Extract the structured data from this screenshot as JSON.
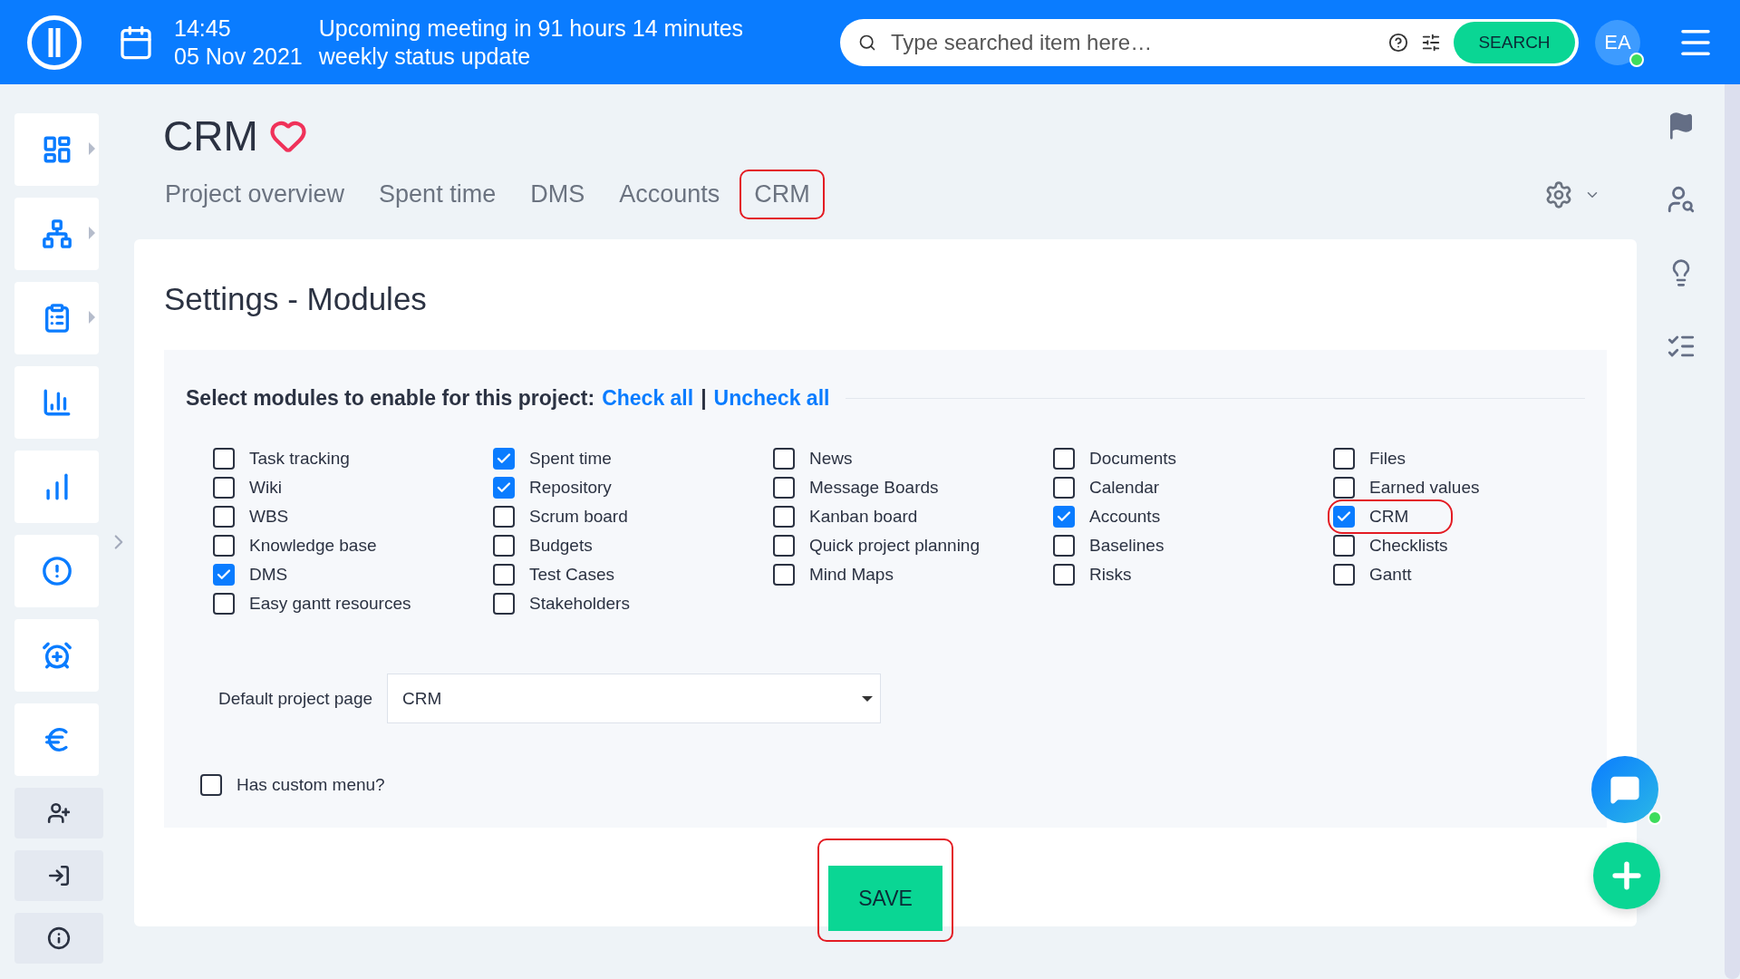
{
  "topbar": {
    "time": "14:45",
    "meeting": "Upcoming meeting in 91 hours 14 minutes",
    "date": "05 Nov 2021",
    "meeting_title": "weekly status update",
    "search": {
      "placeholder": "Type searched item here…",
      "button": "SEARCH"
    },
    "avatar": "EA",
    "online": true
  },
  "sidebar": {
    "items": [
      {
        "kind": "tile",
        "submenu": true
      },
      {
        "kind": "tile",
        "submenu": true
      },
      {
        "kind": "tile",
        "submenu": true
      },
      {
        "kind": "tile",
        "submenu": false
      },
      {
        "kind": "tile",
        "submenu": false
      },
      {
        "kind": "tile",
        "submenu": false
      },
      {
        "kind": "tile",
        "submenu": false
      },
      {
        "kind": "tile",
        "submenu": false
      },
      {
        "kind": "action",
        "submenu": false
      },
      {
        "kind": "action",
        "submenu": false
      },
      {
        "kind": "action",
        "submenu": false
      }
    ]
  },
  "project": {
    "title": "CRM",
    "favorite": true
  },
  "tabs": [
    {
      "label": "Project overview",
      "highlighted": false
    },
    {
      "label": "Spent time",
      "highlighted": false
    },
    {
      "label": "DMS",
      "highlighted": false
    },
    {
      "label": "Accounts",
      "highlighted": false
    },
    {
      "label": "CRM",
      "highlighted": true
    }
  ],
  "settings": {
    "heading": "Settings - Modules",
    "prompt": "Select modules to enable for this project:",
    "check_all": "Check all",
    "separator": "|",
    "uncheck_all": "Uncheck all",
    "columns": [
      [
        {
          "label": "Task tracking",
          "checked": false,
          "highlighted": false
        },
        {
          "label": "Wiki",
          "checked": false,
          "highlighted": false
        },
        {
          "label": "WBS",
          "checked": false,
          "highlighted": false
        },
        {
          "label": "Knowledge base",
          "checked": false,
          "highlighted": false
        },
        {
          "label": "DMS",
          "checked": true,
          "highlighted": false
        },
        {
          "label": "Easy gantt resources",
          "checked": false,
          "highlighted": false
        }
      ],
      [
        {
          "label": "Spent time",
          "checked": true,
          "highlighted": false
        },
        {
          "label": "Repository",
          "checked": true,
          "highlighted": false
        },
        {
          "label": "Scrum board",
          "checked": false,
          "highlighted": false
        },
        {
          "label": "Budgets",
          "checked": false,
          "highlighted": false
        },
        {
          "label": "Test Cases",
          "checked": false,
          "highlighted": false
        },
        {
          "label": "Stakeholders",
          "checked": false,
          "highlighted": false
        }
      ],
      [
        {
          "label": "News",
          "checked": false,
          "highlighted": false
        },
        {
          "label": "Message Boards",
          "checked": false,
          "highlighted": false
        },
        {
          "label": "Kanban board",
          "checked": false,
          "highlighted": false
        },
        {
          "label": "Quick project planning",
          "checked": false,
          "highlighted": false
        },
        {
          "label": "Mind Maps",
          "checked": false,
          "highlighted": false
        }
      ],
      [
        {
          "label": "Documents",
          "checked": false,
          "highlighted": false
        },
        {
          "label": "Calendar",
          "checked": false,
          "highlighted": false
        },
        {
          "label": "Accounts",
          "checked": true,
          "highlighted": false
        },
        {
          "label": "Baselines",
          "checked": false,
          "highlighted": false
        },
        {
          "label": "Risks",
          "checked": false,
          "highlighted": false
        }
      ],
      [
        {
          "label": "Files",
          "checked": false,
          "highlighted": false
        },
        {
          "label": "Earned values",
          "checked": false,
          "highlighted": false
        },
        {
          "label": "CRM",
          "checked": true,
          "highlighted": true
        },
        {
          "label": "Checklists",
          "checked": false,
          "highlighted": false
        },
        {
          "label": "Gantt",
          "checked": false,
          "highlighted": false
        }
      ]
    ],
    "default_page": {
      "label": "Default project page",
      "value": "CRM"
    },
    "custom_menu": {
      "label": "Has custom menu?",
      "checked": false
    },
    "save": {
      "label": "SAVE",
      "highlighted": true
    }
  },
  "chat": {
    "online": true
  }
}
